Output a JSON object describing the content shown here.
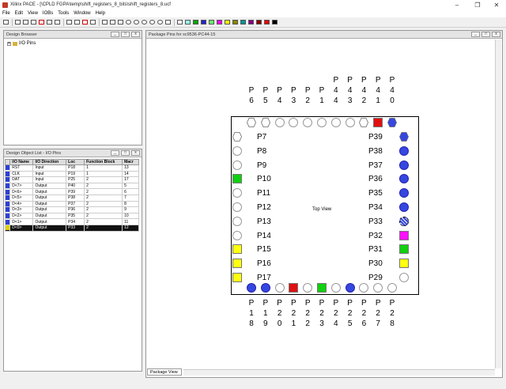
{
  "window": {
    "title": "Xilinx PACE - [\\CPLD FGPA\\temp\\shift_registers_8_bits\\shift_registers_8.ucf"
  },
  "menu": [
    "File",
    "Edit",
    "View",
    "IOBs",
    "Tools",
    "Window",
    "Help"
  ],
  "design_browser": {
    "title": "Design Browser",
    "tree_item": "I/O Pins"
  },
  "object_list": {
    "title": "Design Object List - I/O Pins",
    "columns": [
      "I/O Name",
      "I/O Direction",
      "Loc",
      "Function Block",
      "Macr"
    ],
    "rows": [
      {
        "name": "RST",
        "dir": "Input",
        "loc": "P18",
        "fb": "1",
        "mc": "13",
        "color": "#2a3fd6"
      },
      {
        "name": "CLK",
        "dir": "Input",
        "loc": "P19",
        "fb": "1",
        "mc": "14",
        "color": "#2a3fd6"
      },
      {
        "name": "DAT",
        "dir": "Input",
        "loc": "P25",
        "fb": "2",
        "mc": "17",
        "color": "#2a3fd6"
      },
      {
        "name": "D<7>",
        "dir": "Output",
        "loc": "P40",
        "fb": "2",
        "mc": "5",
        "color": "#2a3fd6"
      },
      {
        "name": "D<6>",
        "dir": "Output",
        "loc": "P39",
        "fb": "2",
        "mc": "6",
        "color": "#2a3fd6"
      },
      {
        "name": "D<5>",
        "dir": "Output",
        "loc": "P38",
        "fb": "2",
        "mc": "7",
        "color": "#2a3fd6"
      },
      {
        "name": "D<4>",
        "dir": "Output",
        "loc": "P37",
        "fb": "2",
        "mc": "8",
        "color": "#2a3fd6"
      },
      {
        "name": "D<3>",
        "dir": "Output",
        "loc": "P36",
        "fb": "2",
        "mc": "9",
        "color": "#2a3fd6"
      },
      {
        "name": "D<2>",
        "dir": "Output",
        "loc": "P35",
        "fb": "2",
        "mc": "10",
        "color": "#2a3fd6"
      },
      {
        "name": "D<1>",
        "dir": "Output",
        "loc": "P34",
        "fb": "2",
        "mc": "11",
        "color": "#2a3fd6"
      },
      {
        "name": "D<0>",
        "dir": "Output",
        "loc": "P33",
        "fb": "2",
        "mc": "12",
        "color": "#e0d000",
        "selected": true
      }
    ]
  },
  "package": {
    "title": "Package Pins for xc9536-PC44-15",
    "top_view": "Top View",
    "tab": "Package View",
    "left_pins": [
      "P7",
      "P8",
      "P9",
      "P10",
      "P11",
      "P12",
      "P13",
      "P14",
      "P15",
      "P16",
      "P17"
    ],
    "right_pins": [
      "P39",
      "P38",
      "P37",
      "P36",
      "P35",
      "P34",
      "P33",
      "P32",
      "P31",
      "P30",
      "P29"
    ],
    "top_labels": [
      [
        "P",
        "6"
      ],
      [
        "P",
        "5"
      ],
      [
        "P",
        "4"
      ],
      [
        "P",
        "3"
      ],
      [
        "P",
        "2"
      ],
      [
        "P",
        "1"
      ],
      [
        "P",
        "4",
        "4"
      ],
      [
        "P",
        "4",
        "3"
      ],
      [
        "P",
        "4",
        "2"
      ],
      [
        "P",
        "4",
        "1"
      ],
      [
        "P",
        "4",
        "0"
      ]
    ],
    "bottom_labels": [
      [
        "P",
        "1",
        "8"
      ],
      [
        "P",
        "1",
        "9"
      ],
      [
        "P",
        "2",
        "0"
      ],
      [
        "P",
        "2",
        "1"
      ],
      [
        "P",
        "2",
        "2"
      ],
      [
        "P",
        "2",
        "3"
      ],
      [
        "P",
        "2",
        "4"
      ],
      [
        "P",
        "2",
        "5"
      ],
      [
        "P",
        "2",
        "6"
      ],
      [
        "P",
        "2",
        "7"
      ],
      [
        "P",
        "2",
        "8"
      ]
    ]
  }
}
